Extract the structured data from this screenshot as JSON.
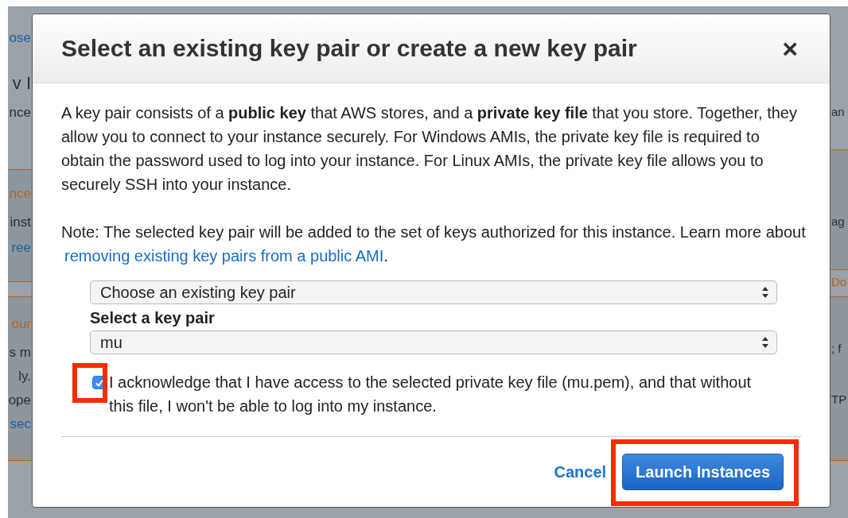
{
  "background_left": [
    {
      "text": "ose",
      "kind": "link"
    },
    {
      "text": "v I",
      "kind": "heading"
    },
    {
      "text": "nce",
      "kind": "text"
    },
    {
      "text": "nce",
      "kind": "accent"
    },
    {
      "text": "inst",
      "kind": "text"
    },
    {
      "text": "ree",
      "kind": "link"
    },
    {
      "text": "our",
      "kind": "accent"
    },
    {
      "text": "s m",
      "kind": "text"
    },
    {
      "text": "ly.",
      "kind": "text"
    },
    {
      "text": "ope",
      "kind": "text"
    },
    {
      "text": "sec",
      "kind": "link"
    }
  ],
  "background_right": [
    {
      "text": "an",
      "kind": "text"
    },
    {
      "text": "ag",
      "kind": "text"
    },
    {
      "text": "Do",
      "kind": "accent"
    },
    {
      "text": "; f",
      "kind": "text"
    },
    {
      "text": "TP",
      "kind": "text"
    }
  ],
  "dialog": {
    "title": "Select an existing key pair or create a new key pair",
    "close": "×",
    "intro": "A key pair consists of a **public key** that AWS stores, and a **private key file** that you store. Together, they allow you to connect to your instance securely. For Windows AMIs, the private key file is required to obtain the password used to log into your instance. For Linux AMIs, the private key file allows you to securely SSH into your instance.",
    "note": "Note: The selected key pair will be added to the set of keys authorized for this instance. Learn more about",
    "note_link": "removing existing key pairs from a public AMI",
    "note_end": ".",
    "mode_select": {
      "value": "Choose an existing key pair"
    },
    "key_label": "Select a key pair",
    "key_select": {
      "value": "mu"
    },
    "acknowledge": {
      "checked": true,
      "highlighted": true,
      "label": "I acknowledge that I have access to the selected private key file (mu.pem), and that without this file, I won't be able to log into my instance."
    },
    "buttons": [
      {
        "label": "Cancel",
        "kind": "link",
        "highlighted": false
      },
      {
        "label": "Launch Instances",
        "kind": "primary",
        "highlighted": true
      }
    ]
  }
}
